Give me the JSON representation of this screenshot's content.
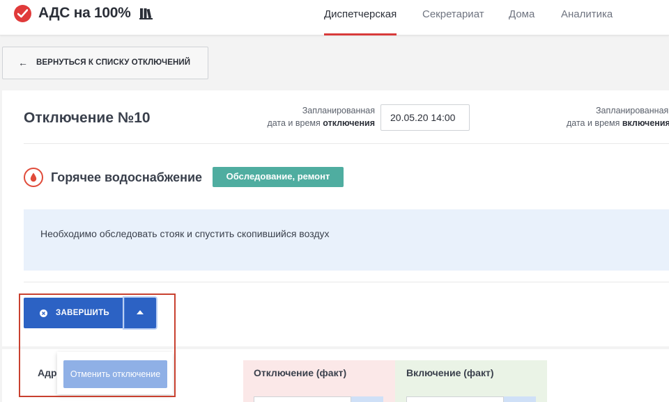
{
  "header": {
    "brand": "АДС на 100%",
    "nav": [
      {
        "label": "Диспетчерская",
        "active": true
      },
      {
        "label": "Секретариат",
        "active": false
      },
      {
        "label": "Дома",
        "active": false
      },
      {
        "label": "Аналитика",
        "active": false
      }
    ]
  },
  "back_button": {
    "arrow": "←",
    "label": "ВЕРНУТЬСЯ К СПИСКУ ОТКЛЮЧЕНИЙ"
  },
  "outage": {
    "title": "Отключение №10",
    "planned_off": {
      "line1": "Запланированная",
      "line2_prefix": "дата и время",
      "line2_bold": "отключения",
      "value": "20.05.20 14:00"
    },
    "planned_on": {
      "line1": "Запланированная",
      "line2_prefix": "дата и время",
      "line2_bold": "включения"
    },
    "service": "Горячее водоснабжение",
    "badge": "Обследование, ремонт",
    "note": "Необходимо обследовать стояк и спустить скопившийся воздух"
  },
  "actions": {
    "finish_label": "ЗАВЕРШИТЬ",
    "dropdown_items": [
      "Отменить отключение"
    ]
  },
  "table": {
    "address_header": "Адрес",
    "off_header": "Отключение (факт)",
    "on_header": "Включение (факт)"
  },
  "colors": {
    "brand_red": "#e03a3a",
    "primary_blue": "#2c62c4",
    "badge_teal": "#4fada0",
    "note_bg": "#e9f1fb",
    "highlight": "#c8402f"
  }
}
